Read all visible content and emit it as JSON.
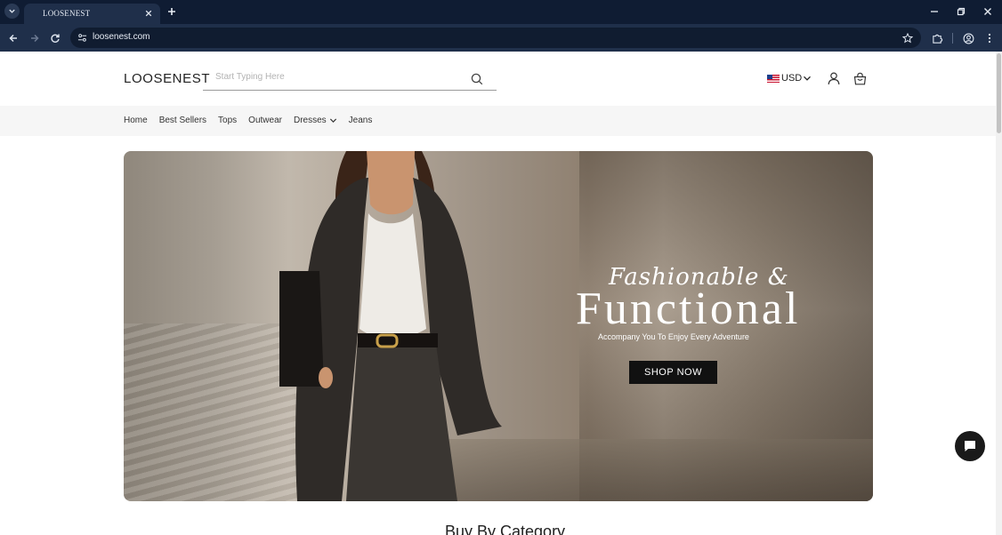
{
  "browser": {
    "tab_title": "LOOSENEST",
    "url": "loosenest.com",
    "colors": {
      "tabbar": "#0f1c33",
      "toolbar": "#1f2f4a"
    }
  },
  "header": {
    "logo": "LOOSENEST",
    "search_placeholder": "Start Typing Here",
    "currency": "USD"
  },
  "nav": {
    "items": [
      {
        "label": "Home"
      },
      {
        "label": "Best Sellers"
      },
      {
        "label": "Tops"
      },
      {
        "label": "Outwear"
      },
      {
        "label": "Dresses",
        "has_dropdown": true
      },
      {
        "label": "Jeans"
      }
    ]
  },
  "hero": {
    "script_line": "Fashionable &",
    "title": "Functional",
    "subtitle": "Accompany You To Enjoy Every Adventure",
    "cta": "SHOP NOW"
  },
  "sections": {
    "category_title": "Buy By Category"
  },
  "icons": [
    "tab-search-icon",
    "close-icon",
    "plus-icon",
    "minimize-icon",
    "restore-icon",
    "back-icon",
    "forward-icon",
    "reload-icon",
    "site-info-icon",
    "star-icon",
    "extensions-icon",
    "profile-icon",
    "kebab-menu-icon",
    "search-icon",
    "user-icon",
    "shopping-bag-icon",
    "chevron-down-icon",
    "chat-icon"
  ]
}
